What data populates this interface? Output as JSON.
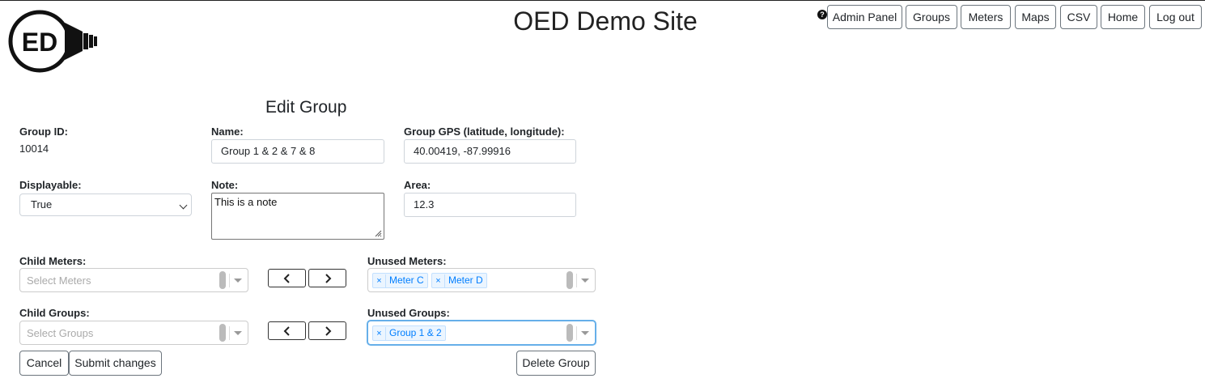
{
  "site": {
    "title": "OED Demo Site",
    "logo_text": "ED"
  },
  "nav": {
    "help_glyph": "?",
    "items": [
      {
        "label": "Admin Panel"
      },
      {
        "label": "Groups"
      },
      {
        "label": "Meters"
      },
      {
        "label": "Maps"
      },
      {
        "label": "CSV"
      },
      {
        "label": "Home"
      },
      {
        "label": "Log out"
      }
    ]
  },
  "form": {
    "title": "Edit Group",
    "group_id": {
      "label": "Group ID:",
      "value": "10014"
    },
    "name": {
      "label": "Name:",
      "value": "Group 1 & 2 & 7 & 8"
    },
    "gps": {
      "label": "Group GPS (latitude, longitude):",
      "value": "40.00419, -87.99916"
    },
    "displayable": {
      "label": "Displayable:",
      "value": "True"
    },
    "note": {
      "label": "Note:",
      "value": "This is a note"
    },
    "area": {
      "label": "Area:",
      "value": "12.3"
    },
    "child_meters": {
      "label": "Child Meters:",
      "placeholder": "Select Meters"
    },
    "unused_meters": {
      "label": "Unused Meters:",
      "items": [
        "Meter C",
        "Meter D"
      ]
    },
    "child_groups": {
      "label": "Child Groups:",
      "placeholder": "Select Groups"
    },
    "unused_groups": {
      "label": "Unused Groups:",
      "items": [
        "Group 1 & 2"
      ]
    },
    "chip_remove": "×",
    "buttons": {
      "cancel": "Cancel",
      "submit": "Submit changes",
      "delete": "Delete Group"
    }
  },
  "colors": {
    "chip_text": "#007eff",
    "chip_bg": "#ebf5ff",
    "focus_border": "#66afe9"
  }
}
